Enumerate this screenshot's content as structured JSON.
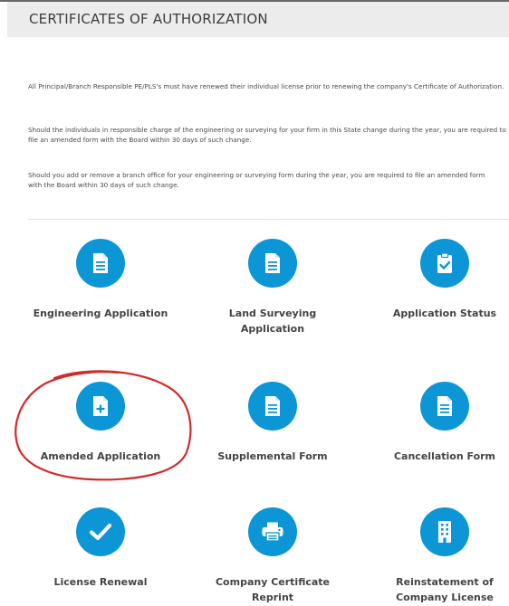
{
  "header": {
    "title": "CERTIFICATES OF AUTHORIZATION"
  },
  "notices": [
    "All Principal/Branch Responsible PE/PLS's must have renewed their individual license prior to renewing the company's Certificate of Authorization.",
    "Should the individuals in responsible charge of the engineering or surveying for your firm in this State change during the year, you are required to file an amended form with the Board within 30 days of such change.",
    "Should you add or remove a branch office for your engineering or surveying form during the year, you are required to file an amended form with the Board within 30 days of such change."
  ],
  "tiles": [
    {
      "label": "Engineering Application",
      "icon": "document-icon"
    },
    {
      "label": "Land Surveying Application",
      "icon": "document-icon"
    },
    {
      "label": "Application Status",
      "icon": "clipboard-check-icon"
    },
    {
      "label": "Amended Application",
      "icon": "document-plus-icon"
    },
    {
      "label": "Supplemental Form",
      "icon": "document-icon"
    },
    {
      "label": "Cancellation Form",
      "icon": "document-icon"
    },
    {
      "label": "License Renewal",
      "icon": "checkmark-icon"
    },
    {
      "label": "Company Certificate Reprint",
      "icon": "printer-icon"
    },
    {
      "label": "Reinstatement of Company License",
      "icon": "building-icon"
    }
  ],
  "colors": {
    "accent": "#0d96d6",
    "title_bar": "#ececec",
    "annotation": "#d42a2a"
  }
}
